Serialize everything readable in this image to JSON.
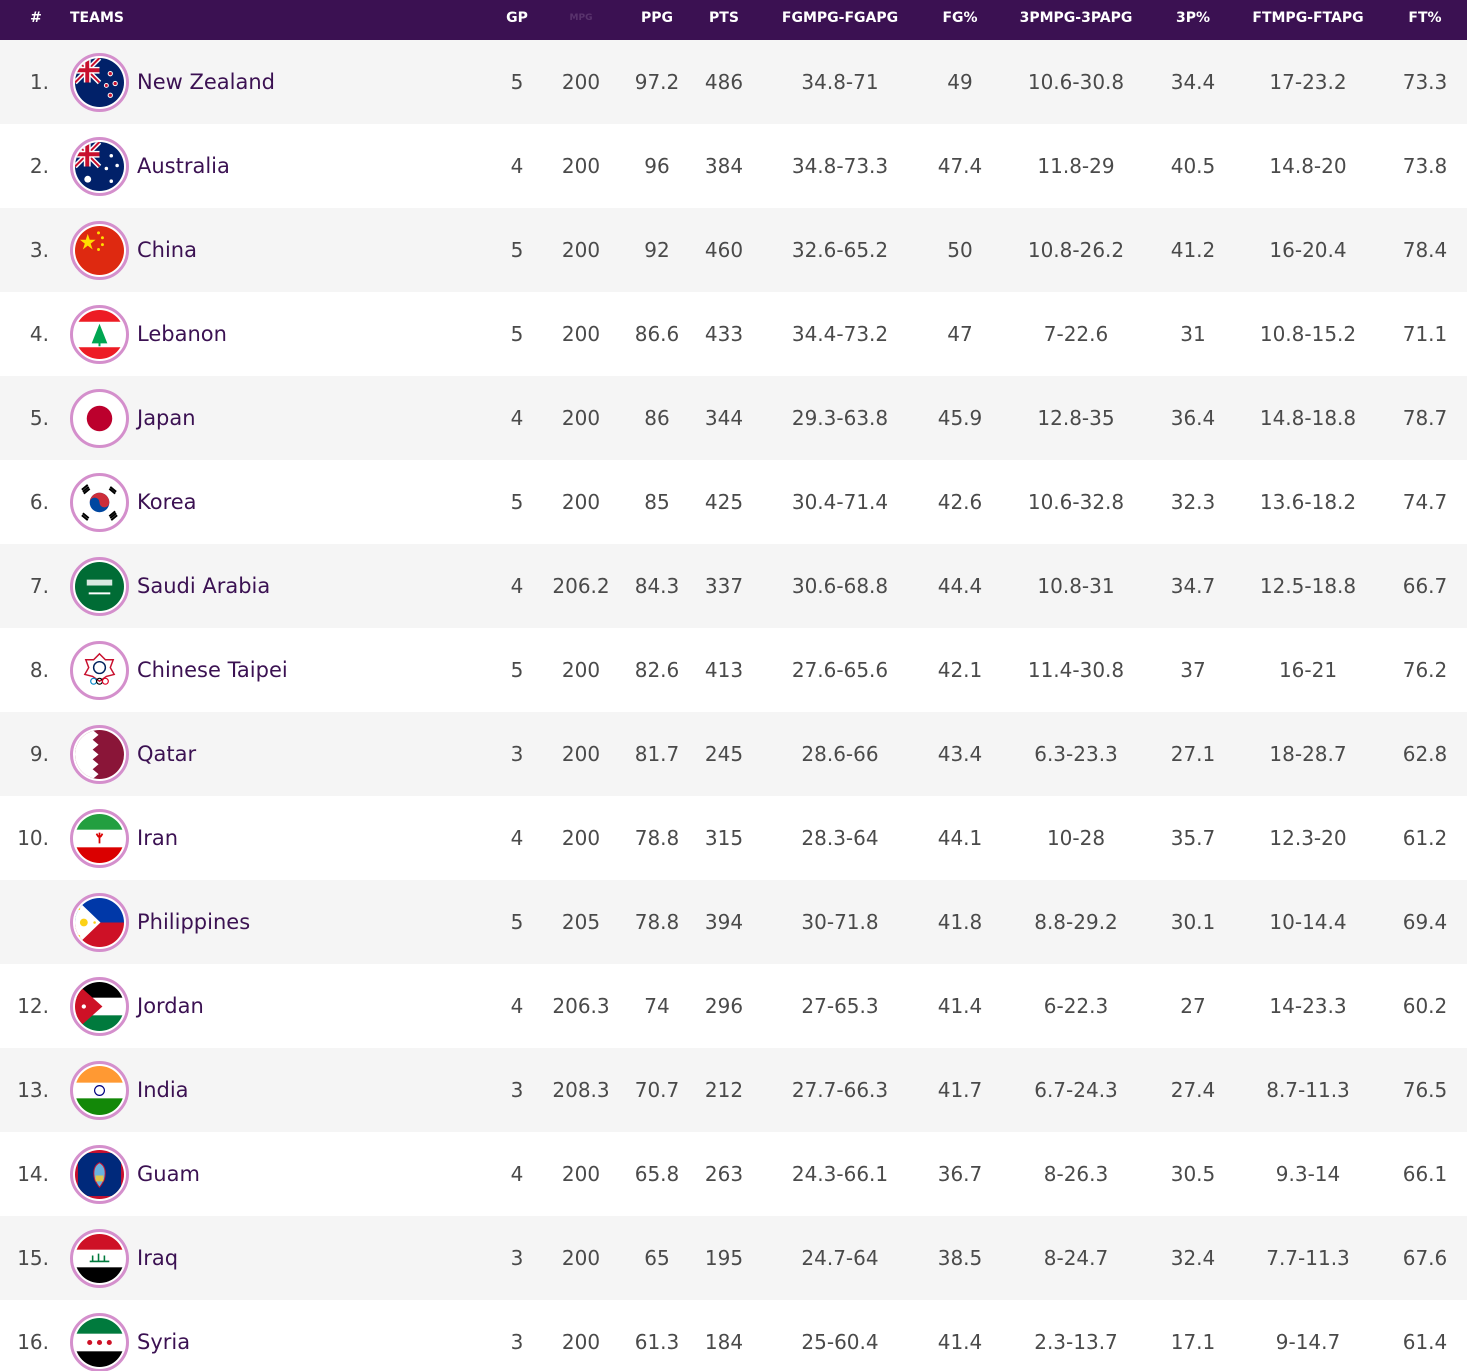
{
  "header": {
    "rank": "#",
    "teams": "TEAMS",
    "gp": "GP",
    "mins": "MPG",
    "ppg": "PPG",
    "pts": "PTS",
    "fg": "FGMPG-FGAPG",
    "fgp": "FG%",
    "tp": "3PMPG-3PAPG",
    "tpp": "3P%",
    "ft": "FTMPG-FTAPG",
    "ftp": "FT%"
  },
  "rows": [
    {
      "rank": "1.",
      "team": "New Zealand",
      "flag": "new-zealand-flag-icon",
      "gp": "5",
      "mins": "200",
      "ppg": "97.2",
      "pts": "486",
      "fg": "34.8-71",
      "fgp": "49",
      "tp": "10.6-30.8",
      "tpp": "34.4",
      "ft": "17-23.2",
      "ftp": "73.3"
    },
    {
      "rank": "2.",
      "team": "Australia",
      "flag": "australia-flag-icon",
      "gp": "4",
      "mins": "200",
      "ppg": "96",
      "pts": "384",
      "fg": "34.8-73.3",
      "fgp": "47.4",
      "tp": "11.8-29",
      "tpp": "40.5",
      "ft": "14.8-20",
      "ftp": "73.8"
    },
    {
      "rank": "3.",
      "team": "China",
      "flag": "china-flag-icon",
      "gp": "5",
      "mins": "200",
      "ppg": "92",
      "pts": "460",
      "fg": "32.6-65.2",
      "fgp": "50",
      "tp": "10.8-26.2",
      "tpp": "41.2",
      "ft": "16-20.4",
      "ftp": "78.4"
    },
    {
      "rank": "4.",
      "team": "Lebanon",
      "flag": "lebanon-flag-icon",
      "gp": "5",
      "mins": "200",
      "ppg": "86.6",
      "pts": "433",
      "fg": "34.4-73.2",
      "fgp": "47",
      "tp": "7-22.6",
      "tpp": "31",
      "ft": "10.8-15.2",
      "ftp": "71.1"
    },
    {
      "rank": "5.",
      "team": "Japan",
      "flag": "japan-flag-icon",
      "gp": "4",
      "mins": "200",
      "ppg": "86",
      "pts": "344",
      "fg": "29.3-63.8",
      "fgp": "45.9",
      "tp": "12.8-35",
      "tpp": "36.4",
      "ft": "14.8-18.8",
      "ftp": "78.7"
    },
    {
      "rank": "6.",
      "team": "Korea",
      "flag": "korea-flag-icon",
      "gp": "5",
      "mins": "200",
      "ppg": "85",
      "pts": "425",
      "fg": "30.4-71.4",
      "fgp": "42.6",
      "tp": "10.6-32.8",
      "tpp": "32.3",
      "ft": "13.6-18.2",
      "ftp": "74.7"
    },
    {
      "rank": "7.",
      "team": "Saudi Arabia",
      "flag": "saudi-arabia-flag-icon",
      "gp": "4",
      "mins": "206.2",
      "ppg": "84.3",
      "pts": "337",
      "fg": "30.6-68.8",
      "fgp": "44.4",
      "tp": "10.8-31",
      "tpp": "34.7",
      "ft": "12.5-18.8",
      "ftp": "66.7"
    },
    {
      "rank": "8.",
      "team": "Chinese Taipei",
      "flag": "chinese-taipei-flag-icon",
      "gp": "5",
      "mins": "200",
      "ppg": "82.6",
      "pts": "413",
      "fg": "27.6-65.6",
      "fgp": "42.1",
      "tp": "11.4-30.8",
      "tpp": "37",
      "ft": "16-21",
      "ftp": "76.2"
    },
    {
      "rank": "9.",
      "team": "Qatar",
      "flag": "qatar-flag-icon",
      "gp": "3",
      "mins": "200",
      "ppg": "81.7",
      "pts": "245",
      "fg": "28.6-66",
      "fgp": "43.4",
      "tp": "6.3-23.3",
      "tpp": "27.1",
      "ft": "18-28.7",
      "ftp": "62.8"
    },
    {
      "rank": "10.",
      "team": "Iran",
      "flag": "iran-flag-icon",
      "gp": "4",
      "mins": "200",
      "ppg": "78.8",
      "pts": "315",
      "fg": "28.3-64",
      "fgp": "44.1",
      "tp": "10-28",
      "tpp": "35.7",
      "ft": "12.3-20",
      "ftp": "61.2"
    },
    {
      "rank": "",
      "team": "Philippines",
      "flag": "philippines-flag-icon",
      "gp": "5",
      "mins": "205",
      "ppg": "78.8",
      "pts": "394",
      "fg": "30-71.8",
      "fgp": "41.8",
      "tp": "8.8-29.2",
      "tpp": "30.1",
      "ft": "10-14.4",
      "ftp": "69.4"
    },
    {
      "rank": "12.",
      "team": "Jordan",
      "flag": "jordan-flag-icon",
      "gp": "4",
      "mins": "206.3",
      "ppg": "74",
      "pts": "296",
      "fg": "27-65.3",
      "fgp": "41.4",
      "tp": "6-22.3",
      "tpp": "27",
      "ft": "14-23.3",
      "ftp": "60.2"
    },
    {
      "rank": "13.",
      "team": "India",
      "flag": "india-flag-icon",
      "gp": "3",
      "mins": "208.3",
      "ppg": "70.7",
      "pts": "212",
      "fg": "27.7-66.3",
      "fgp": "41.7",
      "tp": "6.7-24.3",
      "tpp": "27.4",
      "ft": "8.7-11.3",
      "ftp": "76.5"
    },
    {
      "rank": "14.",
      "team": "Guam",
      "flag": "guam-flag-icon",
      "gp": "4",
      "mins": "200",
      "ppg": "65.8",
      "pts": "263",
      "fg": "24.3-66.1",
      "fgp": "36.7",
      "tp": "8-26.3",
      "tpp": "30.5",
      "ft": "9.3-14",
      "ftp": "66.1"
    },
    {
      "rank": "15.",
      "team": "Iraq",
      "flag": "iraq-flag-icon",
      "gp": "3",
      "mins": "200",
      "ppg": "65",
      "pts": "195",
      "fg": "24.7-64",
      "fgp": "38.5",
      "tp": "8-24.7",
      "tpp": "32.4",
      "ft": "7.7-11.3",
      "ftp": "67.6"
    },
    {
      "rank": "16.",
      "team": "Syria",
      "flag": "syria-flag-icon",
      "gp": "3",
      "mins": "200",
      "ppg": "61.3",
      "pts": "184",
      "fg": "25-60.4",
      "fgp": "41.4",
      "tp": "2.3-13.7",
      "tpp": "17.1",
      "ft": "9-14.7",
      "ftp": "61.4"
    }
  ]
}
